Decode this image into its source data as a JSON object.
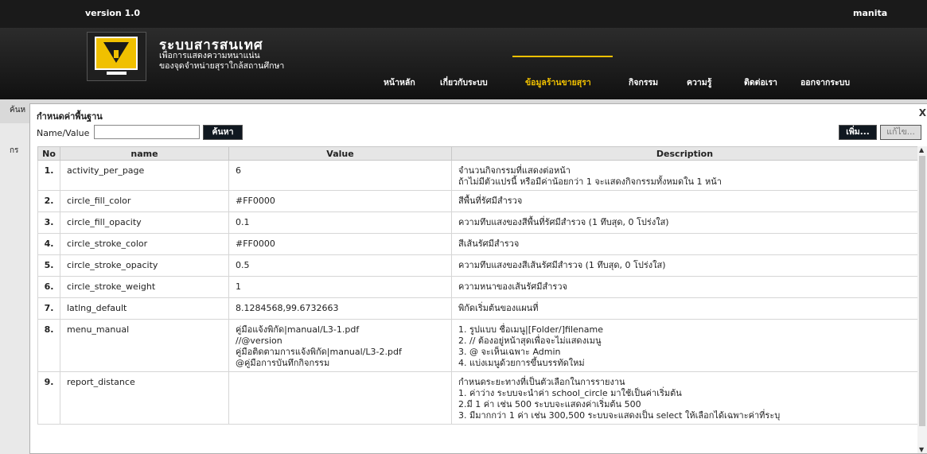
{
  "topbar": {
    "version": "version 1.0",
    "user": "manita"
  },
  "brand": {
    "title": "ระบบสารสนเทศ",
    "line1": "เพื่อการแสดงความหนาแน่น",
    "line2": "ของจุดจำหน่ายสุราใกล้สถานศึกษา"
  },
  "nav": [
    {
      "label": "หน้าหลัก"
    },
    {
      "label": "เกี่ยวกับระบบ"
    },
    {
      "label": "ข้อมูลร้านขายสุรา"
    },
    {
      "label": "กิจกรรม"
    },
    {
      "label": "ความรู้"
    },
    {
      "label": "ติดต่อเรา"
    },
    {
      "label": "ออกจากระบบ"
    }
  ],
  "background": {
    "label1": "ค้นห",
    "label2": "กร"
  },
  "dialog": {
    "title": "กำหนดค่าพื้นฐาน",
    "close": "X",
    "filter_label": "Name/Value",
    "filter_value": "",
    "search_button": "ค้นหา",
    "add_button": "เพิ่ม...",
    "edit_button": "แก้ไข..."
  },
  "table": {
    "headers": [
      "No",
      "name",
      "Value",
      "Description"
    ],
    "rows": [
      {
        "no": "1.",
        "name": "activity_per_page",
        "value": [
          "6"
        ],
        "desc": [
          "จำนวนกิจกรรมที่แสดงต่อหน้า",
          "ถ้าไม่มีตัวแปรนี้ หรือมีค่าน้อยกว่า 1 จะแสดงกิจกรรมทั้งหมดใน 1 หน้า"
        ]
      },
      {
        "no": "2.",
        "name": "circle_fill_color",
        "value": [
          "#FF0000"
        ],
        "desc": [
          "สีพื้นที่รัศมีสำรวจ"
        ]
      },
      {
        "no": "3.",
        "name": "circle_fill_opacity",
        "value": [
          "0.1"
        ],
        "desc": [
          "ความทึบแสงของสีพื้นที่รัศมีสำรวจ (1 ทึบสุด, 0 โปร่งใส)"
        ]
      },
      {
        "no": "4.",
        "name": "circle_stroke_color",
        "value": [
          "#FF0000"
        ],
        "desc": [
          "สีเส้นรัศมีสำรวจ"
        ]
      },
      {
        "no": "5.",
        "name": "circle_stroke_opacity",
        "value": [
          "0.5"
        ],
        "desc": [
          "ความทึบแสงของสีเส้นรัศมีสำรวจ (1 ทึบสุด, 0 โปร่งใส)"
        ]
      },
      {
        "no": "6.",
        "name": "circle_stroke_weight",
        "value": [
          "1"
        ],
        "desc": [
          "ความหนาของเส้นรัศมีสำรวจ"
        ]
      },
      {
        "no": "7.",
        "name": "latlng_default",
        "value": [
          "8.1284568,99.6732663"
        ],
        "desc": [
          "พิกัดเริ่มต้นของแผนที่"
        ]
      },
      {
        "no": "8.",
        "name": "menu_manual",
        "value": [
          "คู่มือแจ้งพิกัด|manual/L3-1.pdf",
          "//@version",
          "คู่มือติดตามการแจ้งพิกัด|manual/L3-2.pdf",
          "@คู่มือการบันทึกกิจกรรม"
        ],
        "desc": [
          "1. รูปแบบ ชื่อเมนู|[Folder/]filename",
          "2. // ต้องอยู่หน้าสุดเพื่อจะไม่แสดงเมนู",
          "3. @ จะเห็นเฉพาะ Admin",
          "4. แบ่งเมนูด้วยการขึ้นบรรทัดใหม่"
        ]
      },
      {
        "no": "9.",
        "name": "report_distance",
        "value": [
          ""
        ],
        "desc": [
          "กำหนดระยะทางที่เป็นตัวเลือกในการรายงาน",
          "1. ค่าว่าง ระบบจะนำค่า school_circle มาใช้เป็นค่าเริ่มต้น",
          "2.มี 1 ค่า เช่น 500 ระบบจะแสดงค่าเริ่มต้น 500",
          "3. มีมากกว่า 1 ค่า เช่น 300,500 ระบบจะแสดงเป็น select ให้เลือกได้เฉพาะค่าที่ระบุ"
        ]
      }
    ]
  },
  "colors": {
    "accent": "#f0c000",
    "dark": "#101820"
  },
  "icons": {
    "logo": "tv-wine-glass-icon",
    "scroll_up": "arrow-up-icon",
    "scroll_down": "arrow-down-icon"
  }
}
